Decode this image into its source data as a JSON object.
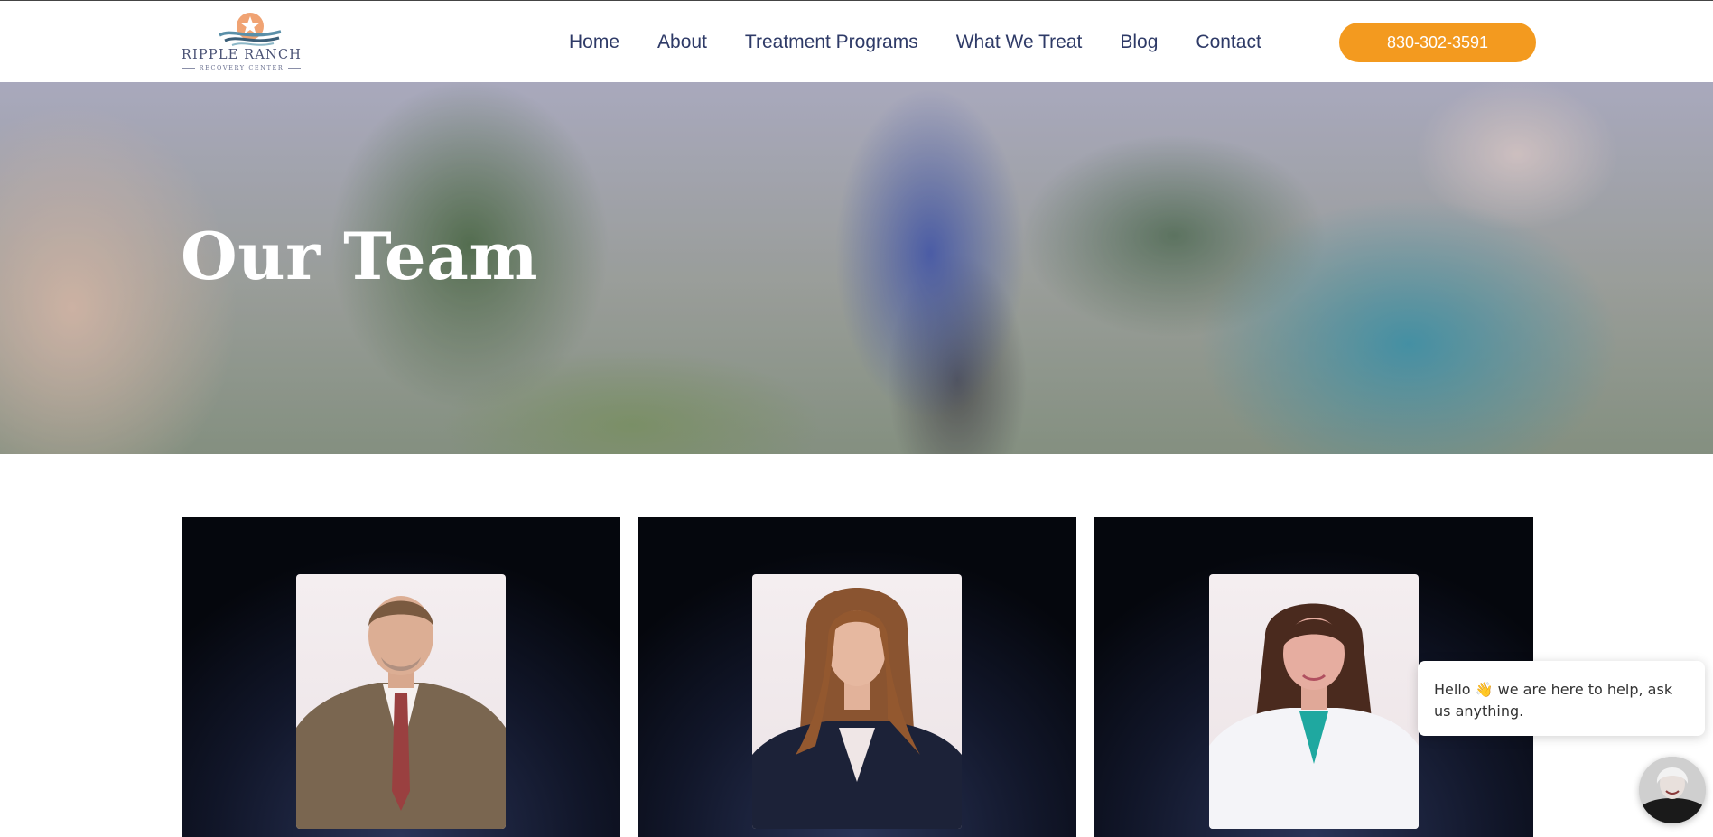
{
  "brand": {
    "name": "RIPPLE RANCH",
    "tagline": "RECOVERY CENTER"
  },
  "nav": {
    "items": [
      {
        "label": "Home"
      },
      {
        "label": "About"
      },
      {
        "label": "Treatment Programs"
      },
      {
        "label": "What We Treat"
      },
      {
        "label": "Blog"
      },
      {
        "label": "Contact"
      }
    ],
    "phone": "830-302-3591"
  },
  "hero": {
    "title": "Our Team"
  },
  "chat": {
    "greeting": "Hello 👋 we are here to help, ask us anything."
  },
  "colors": {
    "accent": "#f39a1f",
    "nav_text": "#2e3a67",
    "card_bg": "#111629"
  }
}
